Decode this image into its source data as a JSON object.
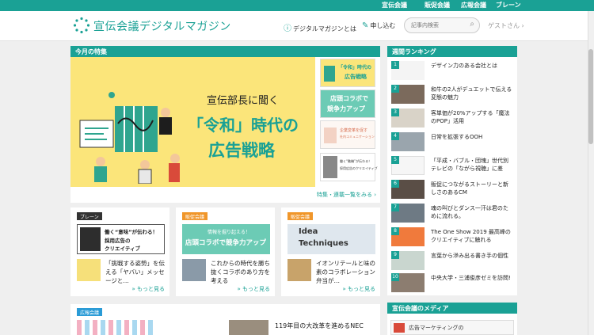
{
  "top_links": [
    "宣伝会議",
    "販促会議",
    "広報会議",
    "ブレーン"
  ],
  "header": {
    "logo_text": "宣伝会議デジタルマガジン",
    "nav_about": "デジタルマガジンとは",
    "nav_apply": "申し込む",
    "search_placeholder": "記事内検索",
    "guest_label": "ゲストさん ›"
  },
  "feature": {
    "section_title": "今月の特集",
    "headline_line1": "宣伝部長に聞く",
    "headline_line2": "「令和」時代の",
    "headline_line3": "広告戦略",
    "side_thumbs": [
      {
        "line1": "「令和」時代の",
        "line2": "広告戦略"
      },
      {
        "line1": "店頭コラボで",
        "line2": "競争力アップ"
      },
      {
        "line1": "企業変革を促す",
        "line2": "社内コミュニケーション"
      },
      {
        "line1": "働く“動機”が伝わる！",
        "line2": "採用広告のクリエイティブ"
      }
    ],
    "link_more": "特集・連載一覧をみる ›"
  },
  "cards": [
    {
      "badge": "ブレーン",
      "badge_color": "#333333",
      "banner_line1": "働く“意味”が伝わる！",
      "banner_line2": "採用広告の",
      "banner_line3": "クリエイティブ",
      "text": "「挑戦する姿勢」を伝える「ヤバい」メッセージと…",
      "more": "» もっと見る"
    },
    {
      "badge": "販促会議",
      "badge_color": "#f0962a",
      "banner_line1": "情報を掘り起える！",
      "banner_line2": "店頭コラボで競争力アップ",
      "text": "これからの時代を勝ち抜くコラボのあり方を考える",
      "more": "» もっと見る"
    },
    {
      "badge": "販促会議",
      "badge_color": "#f0962a",
      "banner_line1": "Idea",
      "banner_line2": "Techniques",
      "text": "イオンリテールと味の素のコラボレーション弁当が…",
      "more": "» もっと見る"
    }
  ],
  "bottom": {
    "badge": "広報会議",
    "badge_color": "#2a9bd6",
    "headline": "119年目の大改革を進めるNEC"
  },
  "ranking": {
    "section_title": "週間ランキング",
    "items": [
      {
        "num": "1",
        "title": "デザイン力のある会社とは"
      },
      {
        "num": "2",
        "title": "和牛の2人がデュエットで伝える変態の魅力"
      },
      {
        "num": "3",
        "title": "客単価が20%アップする「魔法のPOP」活用"
      },
      {
        "num": "4",
        "title": "日常を拡張するOOH"
      },
      {
        "num": "5",
        "title": "「平成・バブル・団塊」世代別テレビの「ながら視聴」に差"
      },
      {
        "num": "6",
        "title": "販促につながるストーリーと新しさのあるCM"
      },
      {
        "num": "7",
        "title": "魂の叫びとダンス一汗は君のために流れる。"
      },
      {
        "num": "8",
        "title": "The One Show 2019 最高峰のクリエイティブに触れる"
      },
      {
        "num": "9",
        "title": "言葉から滲み出る書き手の個性"
      },
      {
        "num": "10",
        "title": "中央大学・三浦俊彦ゼミを訪問!"
      }
    ]
  },
  "media": {
    "section_title": "宣伝会議のメディア",
    "teaser": "広告マーケティングの"
  },
  "colors": {
    "brand": "#1aa195",
    "feature_bg": "#fbe57a",
    "hanbai": "#f0962a"
  }
}
